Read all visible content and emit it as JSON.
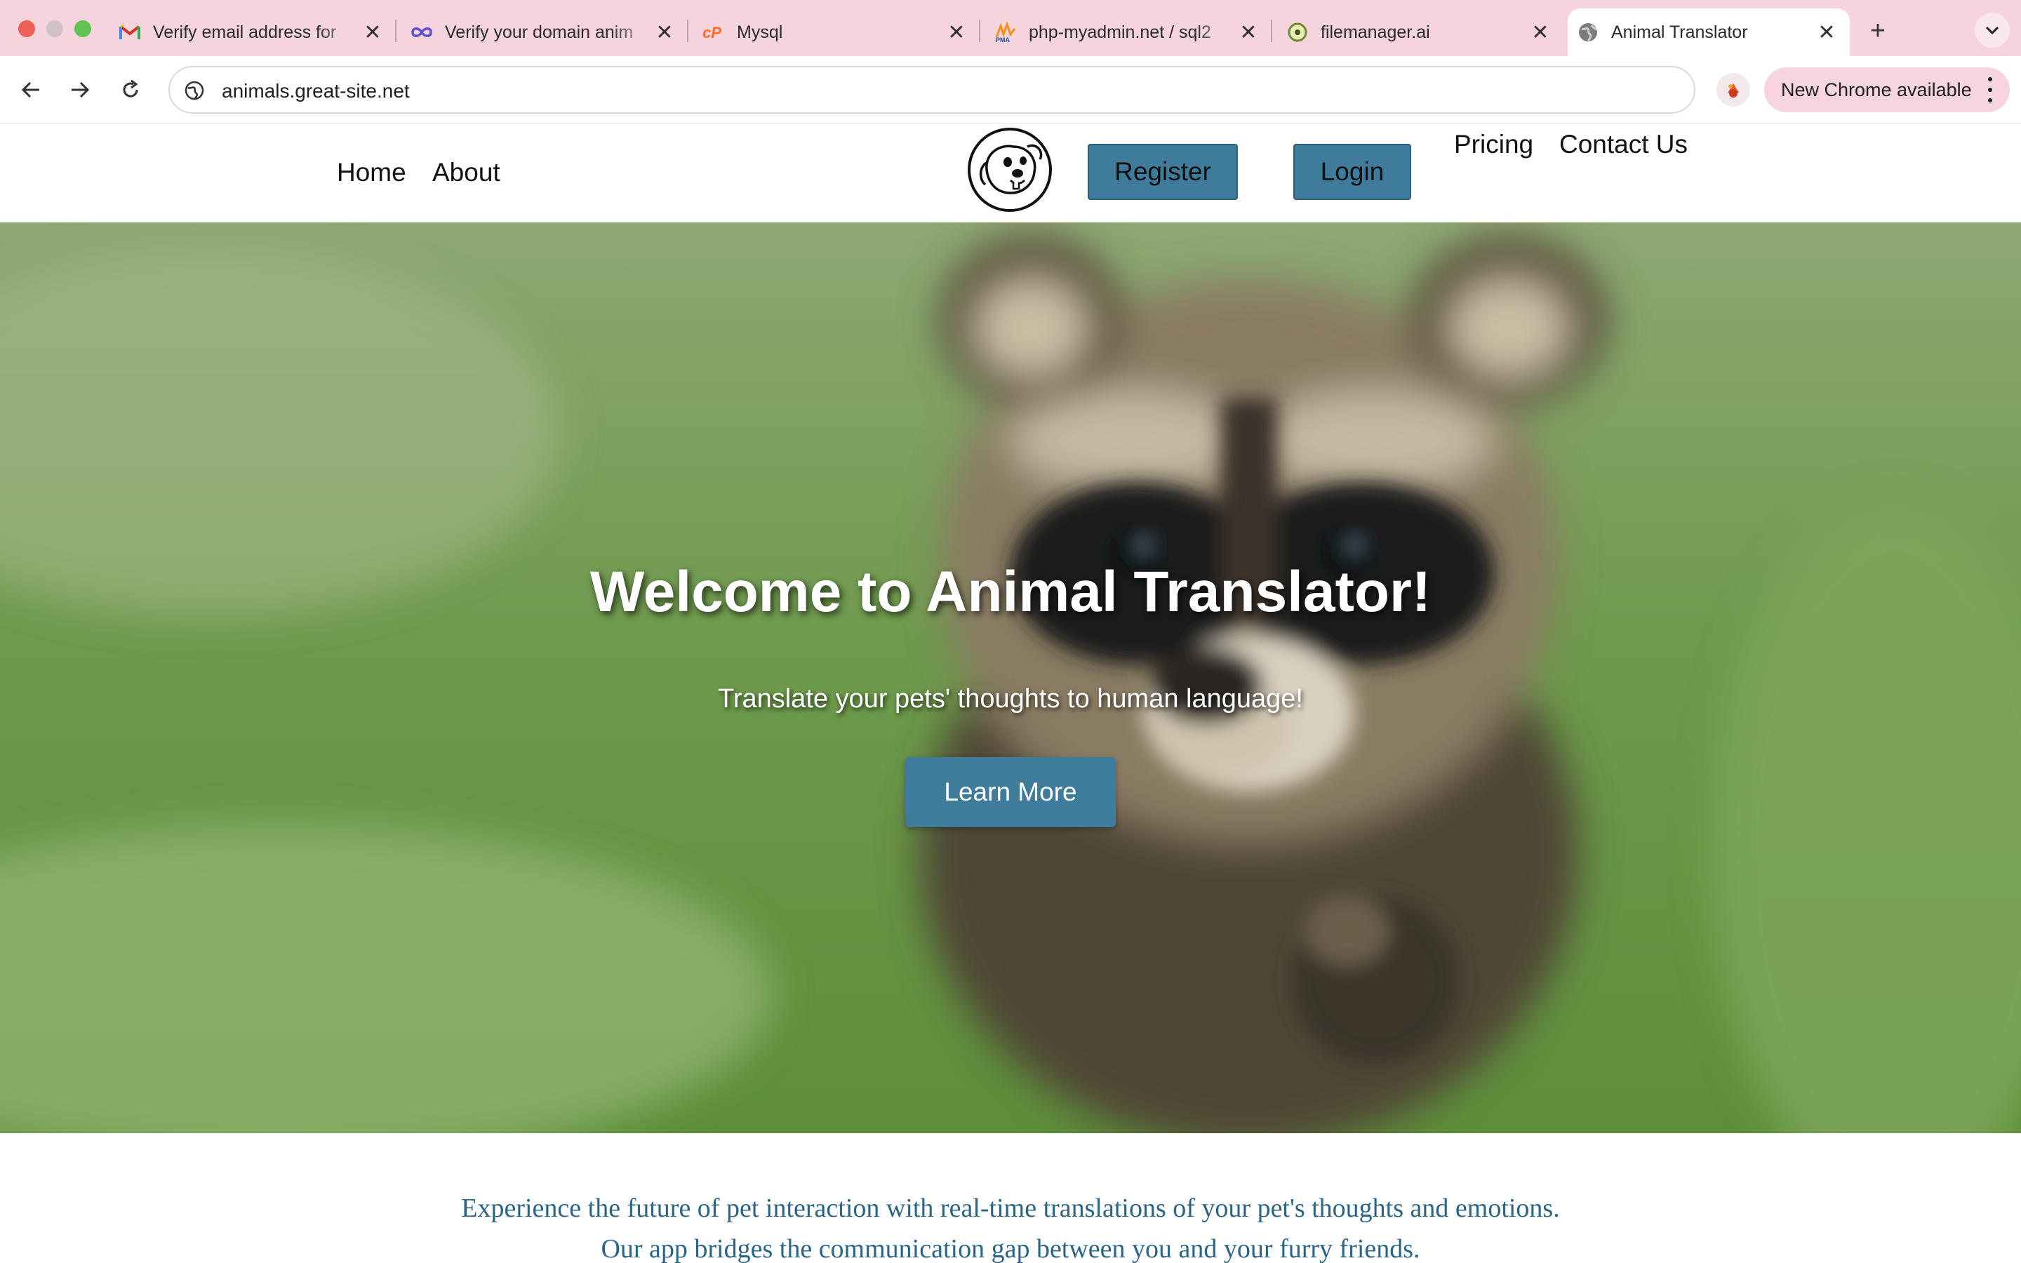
{
  "browser": {
    "tabs": [
      {
        "title": "Verify email address for",
        "icon": "gmail-icon",
        "active": false
      },
      {
        "title": "Verify your domain anim",
        "icon": "infinity-icon",
        "active": false
      },
      {
        "title": "Mysql",
        "icon": "cpanel-icon",
        "active": false
      },
      {
        "title": "php-myadmin.net / sql2",
        "icon": "phpmyadmin-icon",
        "active": false
      },
      {
        "title": "filemanager.ai",
        "icon": "filemanager-icon",
        "active": false
      },
      {
        "title": "Animal Translator",
        "icon": "globe-icon",
        "active": true
      }
    ],
    "new_tab_symbol": "+",
    "close_symbol": "✕",
    "url": "animals.great-site.net",
    "update_label": "New Chrome available",
    "colors": {
      "tabstrip": "#f6d4dd",
      "pill": "#f7d5de"
    }
  },
  "site": {
    "nav": {
      "home": "Home",
      "about": "About",
      "register": "Register",
      "login": "Login",
      "pricing": "Pricing",
      "contact": "Contact Us"
    },
    "hero": {
      "title": "Welcome to Animal Translator!",
      "subtitle": "Translate your pets' thoughts to human language!",
      "button": "Learn More"
    },
    "intro": "Experience the future of pet interaction with real-time translations of your pet's thoughts and emotions. Our app bridges the communication gap between you and your furry friends.",
    "colors": {
      "accent": "#3f7b9a",
      "intro_text": "#2a6586"
    }
  }
}
